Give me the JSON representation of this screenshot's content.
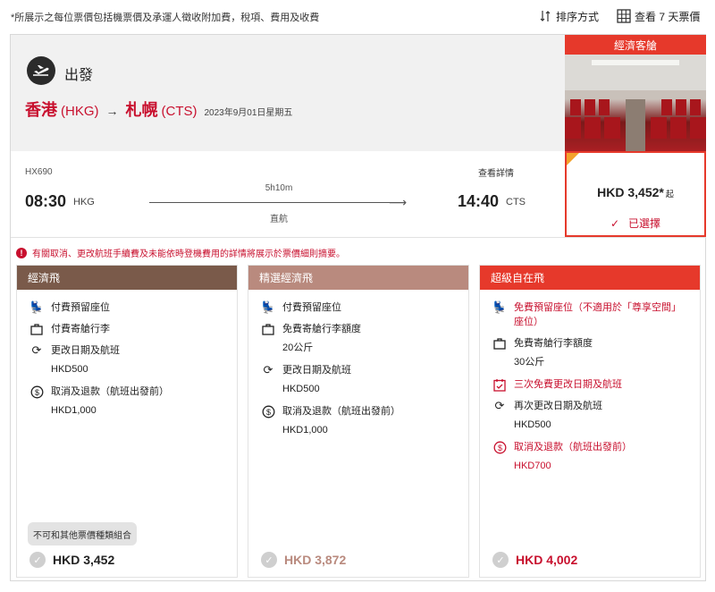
{
  "topbar": {
    "note": "*所展示之每位票價包括機票價及承運人徵收附加費，稅項、費用及收費",
    "sort_label": "排序方式",
    "week_label": "查看 7 天票價"
  },
  "flight": {
    "direction_label": "出發",
    "from_city": "香港",
    "from_code": "(HKG)",
    "to_city": "札幌",
    "to_code": "(CTS)",
    "date": "2023年9月01日星期五",
    "flight_no": "HX690",
    "dep_time": "08:30",
    "dep_port": "HKG",
    "duration": "5h10m",
    "stops": "直航",
    "detail_link": "查看詳情",
    "arr_time": "14:40",
    "arr_port": "CTS"
  },
  "cabin": {
    "title": "經濟客艙",
    "price": "HKD 3,452*",
    "price_suffix": "起",
    "selected_label": "已選擇",
    "accent": "#e6392b"
  },
  "warning": "有關取消、更改航班手續費及未能依時登機費用的詳情將展示於票價細則摘要。",
  "fares": [
    {
      "name": "經濟飛",
      "header_color": "#7a5a4a",
      "features": [
        {
          "icon": "seat-icon",
          "text": "付費預留座位",
          "detail": ""
        },
        {
          "icon": "bag-icon",
          "text": "付費寄艙行李",
          "detail": ""
        },
        {
          "icon": "change-icon",
          "text": "更改日期及航班",
          "detail": "HKD500"
        },
        {
          "icon": "refund-icon",
          "text": "取消及退款（航班出發前）",
          "detail": "HKD1,000"
        }
      ],
      "badge": "不可和其他票價種類組合",
      "price": "HKD 3,452"
    },
    {
      "name": "精選經濟飛",
      "header_color": "#b98a7e",
      "features": [
        {
          "icon": "seat-icon",
          "text": "付費預留座位",
          "detail": ""
        },
        {
          "icon": "bag-icon",
          "text": "免費寄艙行李額度",
          "detail": "20公斤"
        },
        {
          "icon": "change-icon",
          "text": "更改日期及航班",
          "detail": "HKD500"
        },
        {
          "icon": "refund-icon",
          "text": "取消及退款（航班出發前）",
          "detail": "HKD1,000"
        }
      ],
      "price": "HKD 3,872"
    },
    {
      "name": "超級自在飛",
      "header_color": "#e6392b",
      "features": [
        {
          "icon": "seat-icon",
          "text": "免費預留座位（不適用於「尊享空間」座位）",
          "detail": ""
        },
        {
          "icon": "bag-icon",
          "text": "免費寄艙行李額度",
          "detail": "30公斤"
        },
        {
          "icon": "calendar-check-icon",
          "text": "三次免費更改日期及航班",
          "detail": ""
        },
        {
          "icon": "change-icon",
          "text": "再次更改日期及航班",
          "detail": "HKD500"
        },
        {
          "icon": "refund-icon",
          "text": "取消及退款（航班出發前）",
          "detail": "HKD700"
        }
      ],
      "price": "HKD 4,002"
    }
  ]
}
